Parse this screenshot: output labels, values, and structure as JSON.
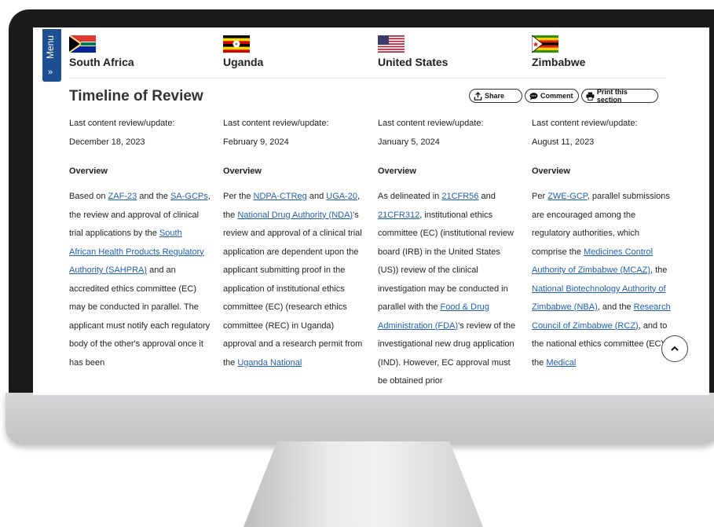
{
  "menu": {
    "label": "Menu",
    "chevron": "»"
  },
  "countries": [
    {
      "name": "South Africa",
      "flag": "south-africa"
    },
    {
      "name": "Uganda",
      "flag": "uganda"
    },
    {
      "name": "United States",
      "flag": "united-states"
    },
    {
      "name": "Zimbabwe",
      "flag": "zimbabwe"
    }
  ],
  "section": {
    "title": "Timeline of Review",
    "share_label": "Share",
    "comment_label": "Comment",
    "print_label": "Print this section"
  },
  "columns": [
    {
      "review_label": "Last content review/update:",
      "review_date": "December 18, 2023",
      "overview_label": "Overview",
      "segments": [
        {
          "t": "Based on "
        },
        {
          "t": "ZAF-23",
          "link": true
        },
        {
          "t": " and the "
        },
        {
          "t": "SA-GCPs",
          "link": true
        },
        {
          "t": ", the review and approval of clinical trial applications by the "
        },
        {
          "t": "South African Health Products Regulatory Authority (SAHPRA)",
          "link": true
        },
        {
          "t": " and an accredited ethics committee (EC) may be conducted in parallel. The applicant must notify each regulatory body of the other's approval once it has been"
        }
      ]
    },
    {
      "review_label": "Last content review/update:",
      "review_date": "February 9, 2024",
      "overview_label": "Overview",
      "segments": [
        {
          "t": "Per the "
        },
        {
          "t": "NDPA-CTReg",
          "link": true
        },
        {
          "t": " and "
        },
        {
          "t": "UGA-20",
          "link": true
        },
        {
          "t": ", the "
        },
        {
          "t": "National Drug Authority (NDA)",
          "link": true
        },
        {
          "t": "'s review and approval of a clinical trial application are dependent upon the applicant submitting proof in the application of institutional ethics committee (EC) (research ethics committee (REC) in Uganda) approval and a research permit from the "
        },
        {
          "t": "Uganda National",
          "link": true
        }
      ]
    },
    {
      "review_label": "Last content review/update:",
      "review_date": "January 5, 2024",
      "overview_label": "Overview",
      "segments": [
        {
          "t": "As delineated in "
        },
        {
          "t": "21CFR56",
          "link": true
        },
        {
          "t": " and "
        },
        {
          "t": "21CFR312",
          "link": true
        },
        {
          "t": ", institutional ethics committee (EC) (institutional review board (IRB) in the United States (US)) review of the clinical investigation may be conducted in parallel with the "
        },
        {
          "t": "Food & Drug Administration (FDA)",
          "link": true
        },
        {
          "t": "'s review of the investigational new drug application (IND). However, EC approval must be obtained prior"
        }
      ]
    },
    {
      "review_label": "Last content review/update:",
      "review_date": "August 11, 2023",
      "overview_label": "Overview",
      "segments": [
        {
          "t": "Per "
        },
        {
          "t": "ZWE-GCP",
          "link": true
        },
        {
          "t": ", parallel submissions are encouraged among the regulatory authorities, which comprise the "
        },
        {
          "t": "Medicines Control Authority of Zimbabwe (MCAZ)",
          "link": true
        },
        {
          "t": ", the "
        },
        {
          "t": "National Biotechnology Authority of Zimbabwe (NBA)",
          "link": true
        },
        {
          "t": ", and the "
        },
        {
          "t": "Research Council of Zimbabwe (RCZ)",
          "link": true
        },
        {
          "t": ", and to the national ethics committee (EC)—the "
        },
        {
          "t": "Medical",
          "link": true
        }
      ]
    }
  ],
  "icons": {
    "share": "share-icon",
    "comment": "comment-icon",
    "print": "print-icon",
    "scroll_top": "chevron-up-icon"
  },
  "colors": {
    "menu_bg": "#1f4f93",
    "link": "#1f5fbf"
  }
}
